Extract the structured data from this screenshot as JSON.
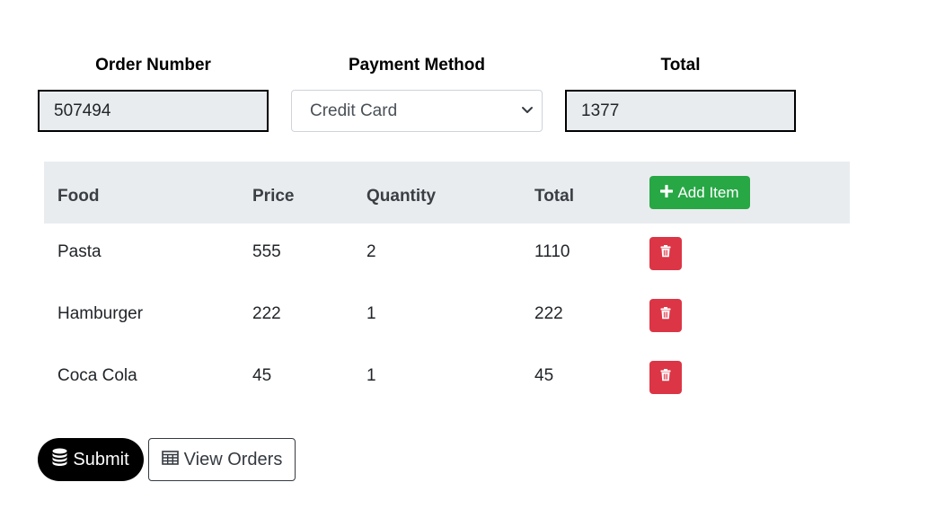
{
  "form": {
    "order_number_label": "Order Number",
    "order_number_value": "507494",
    "payment_method_label": "Payment Method",
    "payment_method_value": "Credit Card",
    "total_label": "Total",
    "total_value": "1377"
  },
  "table": {
    "headers": {
      "food": "Food",
      "price": "Price",
      "quantity": "Quantity",
      "total": "Total"
    },
    "add_button_label": "Add Item",
    "rows": [
      {
        "food": "Pasta",
        "price": "555",
        "quantity": "2",
        "total": "1110"
      },
      {
        "food": "Hamburger",
        "price": "222",
        "quantity": "1",
        "total": "222"
      },
      {
        "food": "Coca Cola",
        "price": "45",
        "quantity": "1",
        "total": "45"
      }
    ]
  },
  "actions": {
    "submit_label": "Submit",
    "view_orders_label": "View Orders"
  },
  "colors": {
    "add_button": "#28a745",
    "delete_button": "#dc3545",
    "submit_button": "#000000",
    "table_header_bg": "#e9ecef"
  },
  "icons": {
    "add": "plus-icon",
    "delete": "trash-icon",
    "submit": "database-icon",
    "view_orders": "table-icon",
    "select": "chevron-down-icon"
  }
}
